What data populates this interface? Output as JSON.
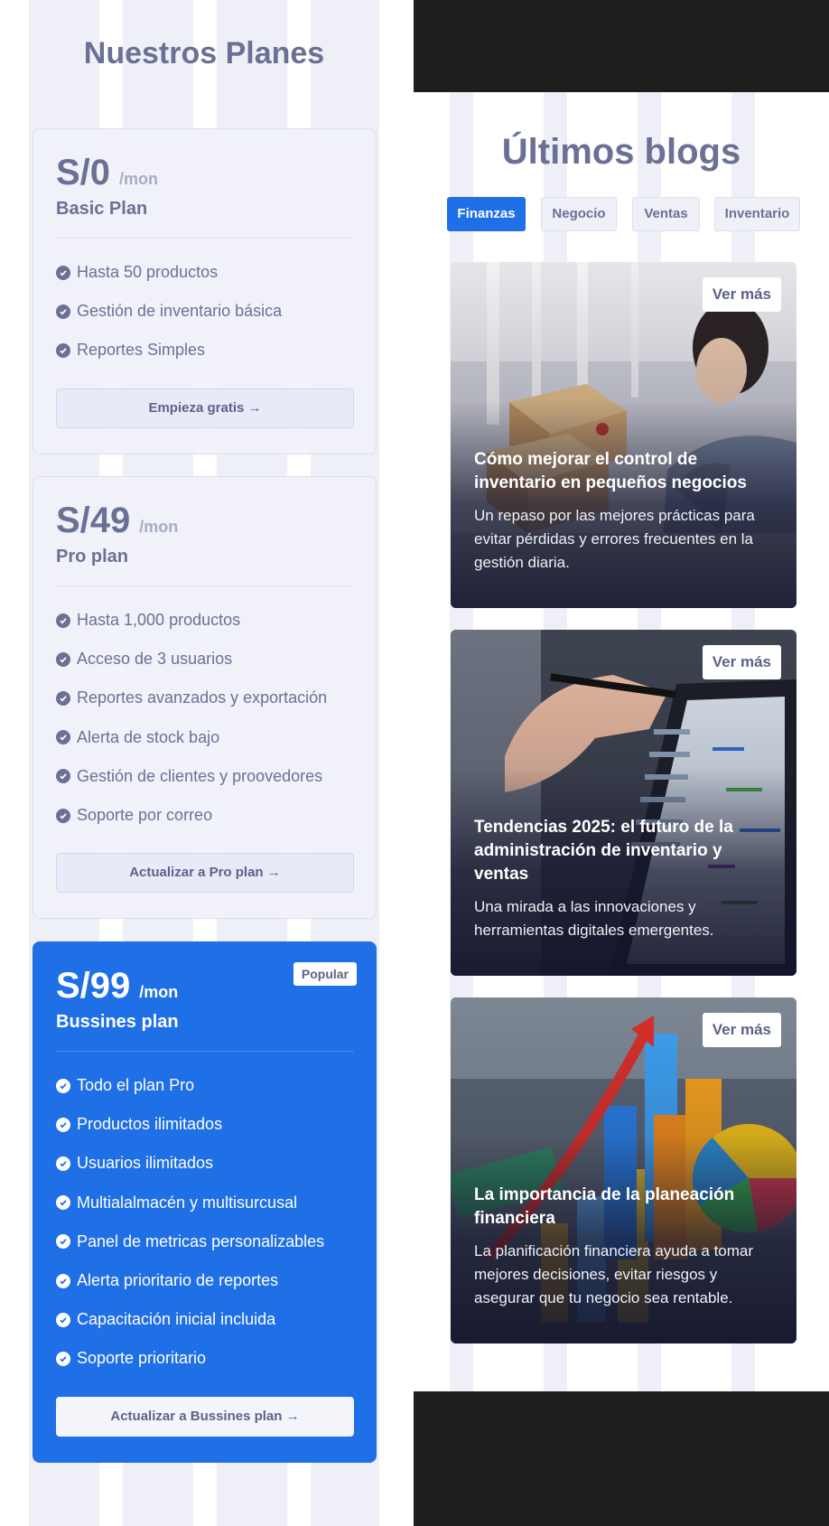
{
  "plans": {
    "title": "Nuestros Planes",
    "items": [
      {
        "price": "S/0",
        "per": "/mon",
        "name": "Basic Plan",
        "features": [
          "Hasta 50 productos",
          "Gestión de inventario básica",
          "Reportes Simples"
        ],
        "button": "Empieza gratis →"
      },
      {
        "price": "S/49",
        "per": "/mon",
        "name": "Pro plan",
        "features": [
          "Hasta 1,000 productos",
          "Acceso de 3 usuarios",
          "Reportes avanzados y exportación",
          "Alerta de stock bajo",
          "Gestión de clientes y proovedores",
          "Soporte por correo"
        ],
        "button": "Actualizar a Pro plan →"
      },
      {
        "price": "S/99",
        "per": "/mon",
        "name": "Bussines plan",
        "badge": "Popular",
        "features": [
          "Todo el plan Pro",
          "Productos ilimitados",
          "Usuarios ilimitados",
          "Multialalmacén y multisurcusal",
          "Panel de metricas personalizables",
          "Alerta prioritario de reportes",
          "Capacitación inicial incluida",
          "Soporte prioritario"
        ],
        "button": "Actualizar a Bussines plan →"
      }
    ]
  },
  "blogs": {
    "title": "Últimos blogs",
    "tabs": [
      "Finanzas",
      "Negocio",
      "Ventas",
      "Inventario"
    ],
    "active_tab": "Finanzas",
    "more_label": "Ver más",
    "posts": [
      {
        "title": "Cómo mejorar el control de inventario en pequeños negocios",
        "description": "Un repaso por las mejores prácticas para evitar pérdidas y errores frecuentes en la gestión diaria."
      },
      {
        "title": "Tendencias 2025: el futuro de la administración de inventario y ventas",
        "description": "Una mirada a las innovaciones y herramientas digitales emergentes."
      },
      {
        "title": "La importancia de la planeación financiera",
        "description": "La planificación financiera ayuda a tomar mejores decisiones, evitar riesgos y asegurar que tu negocio sea rentable."
      }
    ]
  },
  "colors": {
    "primary": "#1f6fe6",
    "text_muted": "#6b7194",
    "dark_band": "#1e1e1e"
  }
}
